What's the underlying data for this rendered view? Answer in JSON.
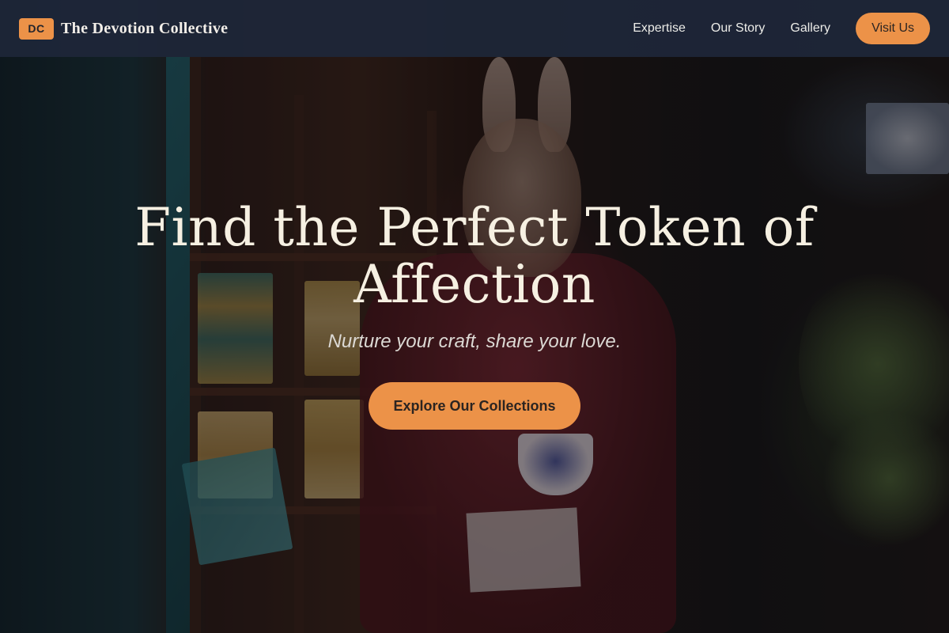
{
  "navbar": {
    "logo_text": "DC",
    "brand_name": "The Devotion Collective",
    "links": [
      {
        "label": "Expertise"
      },
      {
        "label": "Our Story"
      },
      {
        "label": "Gallery"
      }
    ],
    "cta_label": "Visit Us"
  },
  "hero": {
    "title": "Find the Perfect Token of Affection",
    "subtitle": "Nurture your craft, share your love.",
    "cta_label": "Explore Our Collections"
  },
  "colors": {
    "accent": "#ec9248",
    "navbar_bg": "#1e2638",
    "title_text": "#f6f0e2"
  }
}
